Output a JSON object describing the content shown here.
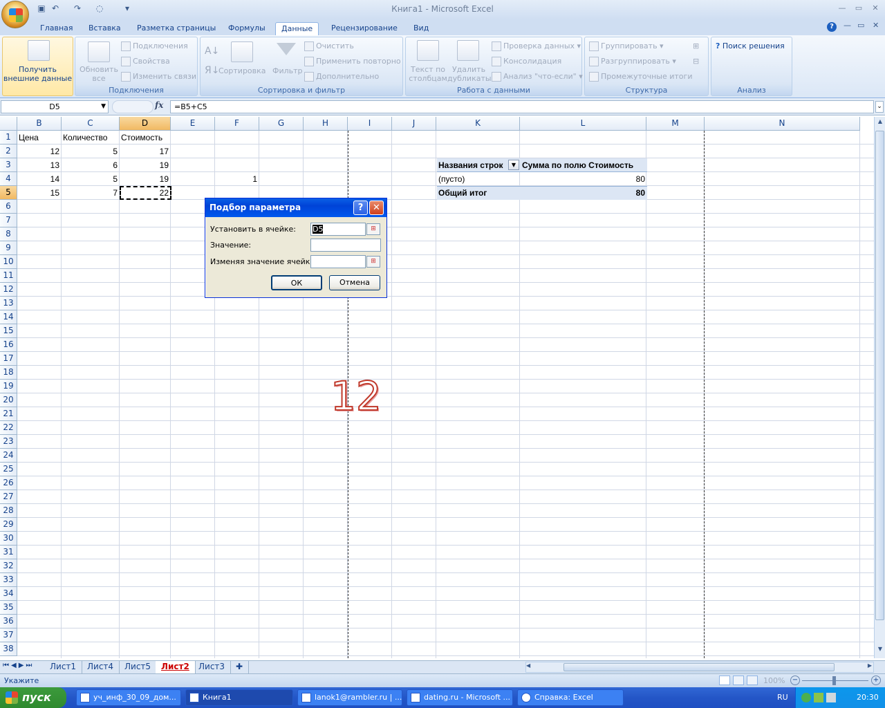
{
  "window": {
    "title": "Книга1 - Microsoft Excel"
  },
  "tabs": [
    {
      "label": "Главная"
    },
    {
      "label": "Вставка"
    },
    {
      "label": "Разметка страницы"
    },
    {
      "label": "Формулы"
    },
    {
      "label": "Данные"
    },
    {
      "label": "Рецензирование"
    },
    {
      "label": "Вид"
    }
  ],
  "ribbon": {
    "get_external": "Получить внешние данные",
    "refresh_all": "Обновить все",
    "connections": "Подключения",
    "properties": "Свойства",
    "edit_links": "Изменить связи",
    "group_connections": "Подключения",
    "sort": "Сортировка",
    "filter": "Фильтр",
    "clear": "Очистить",
    "reapply": "Применить повторно",
    "advanced": "Дополнительно",
    "group_sort": "Сортировка и фильтр",
    "text_to_columns": "Текст по столбцам",
    "remove_duplicates": "Удалить дубликаты",
    "data_validation": "Проверка данных",
    "consolidate": "Консолидация",
    "what_if": "Анализ \"что-если\"",
    "group_tools": "Работа с данными",
    "group": "Группировать",
    "ungroup": "Разгруппировать",
    "subtotal": "Промежуточные итоги",
    "group_outline": "Структура",
    "solver": "Поиск решения",
    "group_analysis": "Анализ"
  },
  "formula_bar": {
    "name_box": "D5",
    "fx": "fx",
    "formula": "=B5+C5"
  },
  "columns": [
    "B",
    "C",
    "D",
    "E",
    "F",
    "G",
    "H",
    "I",
    "J",
    "K",
    "L",
    "M",
    "N"
  ],
  "rows": [
    "1",
    "2",
    "3",
    "4",
    "5",
    "6",
    "7",
    "8",
    "9",
    "10",
    "11",
    "12",
    "13",
    "14",
    "15",
    "16",
    "17",
    "18",
    "19",
    "20",
    "21",
    "22",
    "23",
    "24",
    "25",
    "26",
    "27",
    "28",
    "29",
    "30",
    "31",
    "32",
    "33",
    "34",
    "35",
    "36",
    "37",
    "38"
  ],
  "cells": {
    "B1": "Цена",
    "C1": "Количество",
    "D1": "Стоимость",
    "B2": "12",
    "C2": "5",
    "D2": "17",
    "B3": "13",
    "C3": "6",
    "D3": "19",
    "B4": "14",
    "C4": "5",
    "D4": "19",
    "F4": "1",
    "B5": "15",
    "C5": "7",
    "D5": "22"
  },
  "pivot": {
    "header_rows": "Названия строк",
    "header_sum": "Сумма по полю Стоимость",
    "empty_label": "(пусто)",
    "empty_value": "80",
    "total_label": "Общий итог",
    "total_value": "80"
  },
  "watermark": "12",
  "dialog": {
    "title": "Подбор параметра",
    "help": "?",
    "close": "✕",
    "set_cell_label": "Установить в ячейке:",
    "set_cell_value": "D5",
    "to_value_label": "Значение:",
    "to_value_value": "",
    "changing_label": "Изменяя значение ячейки:",
    "changing_value": "",
    "ok": "ОК",
    "cancel": "Отмена"
  },
  "sheets": [
    {
      "label": "Лист1"
    },
    {
      "label": "Лист4"
    },
    {
      "label": "Лист5"
    },
    {
      "label": "Лист2"
    },
    {
      "label": "Лист3"
    }
  ],
  "status": {
    "mode": "Укажите",
    "zoom": "100%"
  },
  "taskbar": {
    "start": "пуск",
    "tasks": [
      {
        "label": "уч_инф_30_09_дом..."
      },
      {
        "label": "Книга1"
      },
      {
        "label": "lanok1@rambler.ru | ..."
      },
      {
        "label": "dating.ru - Microsoft ..."
      },
      {
        "label": "Справка: Excel"
      }
    ],
    "lang": "RU",
    "clock": "20:30"
  },
  "colors": {
    "accent": "#15428b",
    "selected_header": "#f1b962",
    "pivot_header": "#dce6f4",
    "watermark": "#c0392b"
  }
}
